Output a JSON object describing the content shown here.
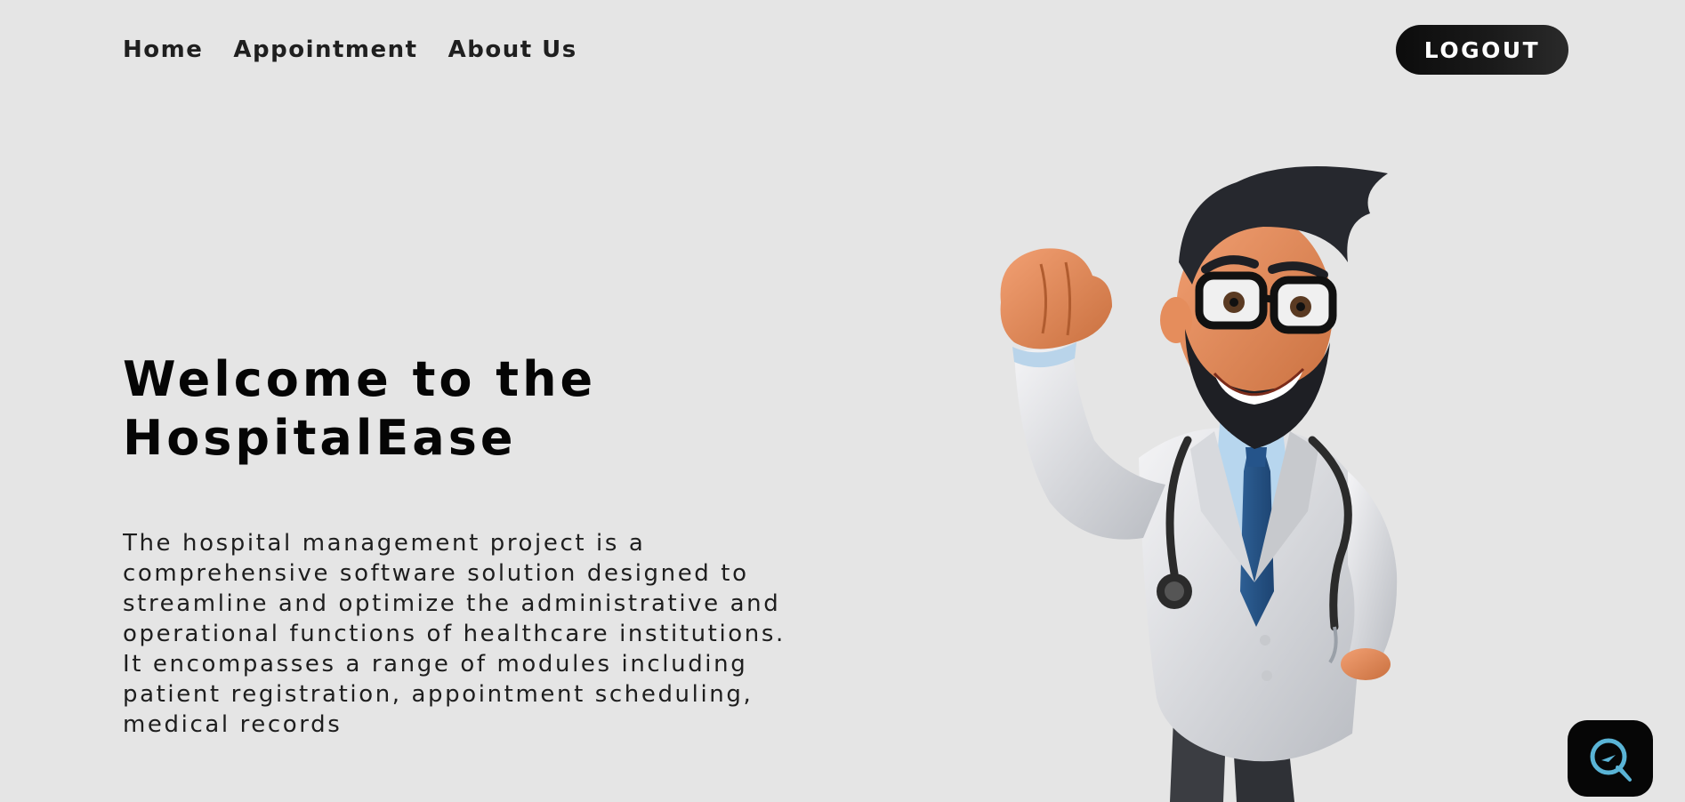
{
  "nav": {
    "items": [
      {
        "label": "Home"
      },
      {
        "label": "Appointment"
      },
      {
        "label": "About Us"
      }
    ],
    "logout_label": "LOGOUT"
  },
  "hero": {
    "title_line1": "Welcome to the",
    "title_line2": "HospitalEase",
    "description": "The hospital management project is a comprehensive software solution designed to streamline and optimize the administrative and operational functions of healthcare institutions. It encompasses a range of modules including patient registration, appointment scheduling, medical records"
  },
  "illustration": {
    "icon": "cartoon-doctor-illustration"
  },
  "chat_widget": {
    "icon": "chat-support-icon",
    "accent_color": "#5ab4d6"
  },
  "colors": {
    "background": "#e5e5e5",
    "button_dark": "#0c0c0c",
    "text": "#1c1c1c"
  }
}
